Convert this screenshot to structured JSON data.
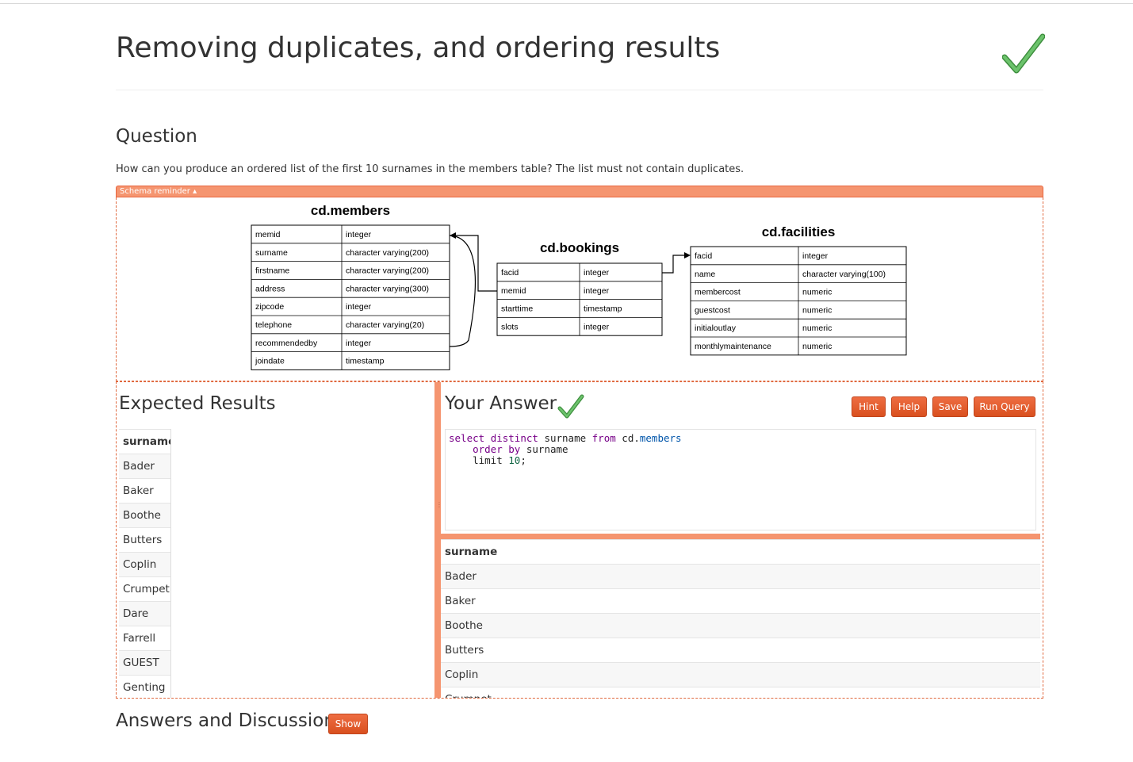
{
  "page": {
    "title": "Removing duplicates, and ordering results"
  },
  "question": {
    "heading": "Question",
    "text": "How can you produce an ordered list of the first 10 surnames in the members table? The list must not contain duplicates.",
    "schema_toggle": "Schema reminder ▴"
  },
  "schema": {
    "tables": [
      {
        "name": "cd.members",
        "columns": [
          [
            "memid",
            "integer"
          ],
          [
            "surname",
            "character varying(200)"
          ],
          [
            "firstname",
            "character varying(200)"
          ],
          [
            "address",
            "character varying(300)"
          ],
          [
            "zipcode",
            "integer"
          ],
          [
            "telephone",
            "character varying(20)"
          ],
          [
            "recommendedby",
            "integer"
          ],
          [
            "joindate",
            "timestamp"
          ]
        ]
      },
      {
        "name": "cd.bookings",
        "columns": [
          [
            "facid",
            "integer"
          ],
          [
            "memid",
            "integer"
          ],
          [
            "starttime",
            "timestamp"
          ],
          [
            "slots",
            "integer"
          ]
        ]
      },
      {
        "name": "cd.facilities",
        "columns": [
          [
            "facid",
            "integer"
          ],
          [
            "name",
            "character varying(100)"
          ],
          [
            "membercost",
            "numeric"
          ],
          [
            "guestcost",
            "numeric"
          ],
          [
            "initialoutlay",
            "numeric"
          ],
          [
            "monthlymaintenance",
            "numeric"
          ]
        ]
      }
    ]
  },
  "expected": {
    "heading": "Expected Results",
    "column": "surname",
    "rows": [
      "Bader",
      "Baker",
      "Boothe",
      "Butters",
      "Coplin",
      "Crumpet",
      "Dare",
      "Farrell",
      "GUEST",
      "Genting"
    ]
  },
  "answer": {
    "heading": "Your Answer",
    "buttons": {
      "hint": "Hint",
      "help": "Help",
      "save": "Save",
      "run": "Run Query"
    },
    "code": {
      "line1": {
        "kw1": "select",
        "kw2": "distinct",
        "col": "surname",
        "kw3": "from",
        "schema": "cd.",
        "table": "members"
      },
      "line2": {
        "kw1": "order",
        "kw2": "by",
        "col": "surname"
      },
      "line3": {
        "kw": "limit",
        "num": "10",
        "end": ";"
      }
    }
  },
  "results": {
    "column": "surname",
    "rows": [
      "Bader",
      "Baker",
      "Boothe",
      "Butters",
      "Coplin",
      "Crumpet"
    ]
  },
  "discussion": {
    "heading": "Answers and Discussion",
    "show_label": "Show"
  },
  "colors": {
    "accent": "#e65b2e",
    "accent_light": "#f59570",
    "check_green": "#5cb85c"
  }
}
